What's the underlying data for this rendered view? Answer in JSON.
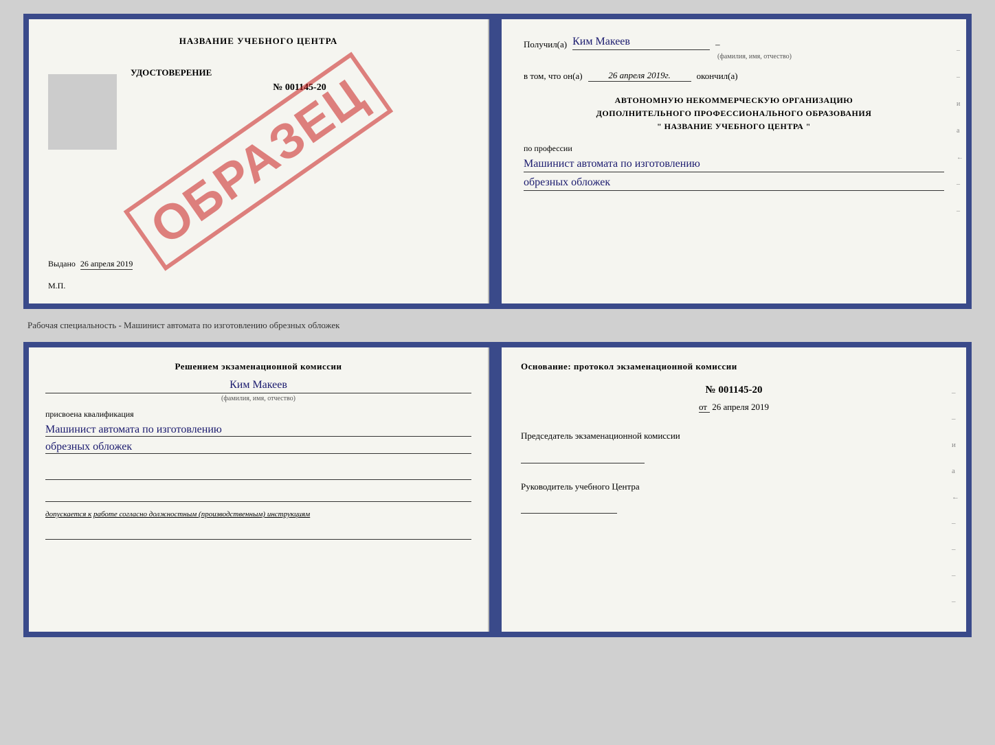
{
  "top_document": {
    "left": {
      "center_title": "НАЗВАНИЕ УЧЕБНОГО ЦЕНТРА",
      "cert_title": "УДОСТОВЕРЕНИЕ",
      "cert_number": "№ 001145-20",
      "issued_label": "Выдано",
      "issued_date": "26 апреля 2019",
      "mp_label": "М.П.",
      "stamp_text": "ОБРАЗЕЦ"
    },
    "right": {
      "received_label": "Получил(а)",
      "recipient_name": "Ким Макеев",
      "fio_subtitle": "(фамилия, имя, отчество)",
      "date_prefix": "в том, что он(а)",
      "date_value": "26 апреля 2019г.",
      "date_suffix": "окончил(а)",
      "org_line1": "АВТОНОМНУЮ НЕКОММЕРЧЕСКУЮ ОРГАНИЗАЦИЮ",
      "org_line2": "ДОПОЛНИТЕЛЬНОГО ПРОФЕССИОНАЛЬНОГО ОБРАЗОВАНИЯ",
      "org_line3": "\" НАЗВАНИЕ УЧЕБНОГО ЦЕНТРА \"",
      "profession_label": "по профессии",
      "profession_line1": "Машинист автомата по изготовлению",
      "profession_line2": "обрезных обложек"
    }
  },
  "between_label": "Рабочая специальность - Машинист автомата по изготовлению обрезных обложек",
  "bottom_document": {
    "left": {
      "decision_text": "Решением экзаменационной комиссии",
      "person_name": "Ким Макеев",
      "person_subtitle": "(фамилия, имя, отчество)",
      "qual_label": "присвоена квалификация",
      "qual_line1": "Машинист автомата по изготовлению",
      "qual_line2": "обрезных обложек",
      "allow_prefix": "допускается к",
      "allow_underline": "работе согласно должностным (производственным) инструкциям"
    },
    "right": {
      "basis_text": "Основание: протокол экзаменационной комиссии",
      "protocol_num": "№ 001145-20",
      "date_prefix": "от",
      "date_value": "26 апреля 2019",
      "commission_chair_label": "Председатель экзаменационной комиссии",
      "director_label": "Руководитель учебного Центра"
    }
  },
  "side_marks": {
    "marks": [
      "–",
      "–",
      "и",
      "а",
      "←",
      "–",
      "–",
      "–",
      "–"
    ]
  }
}
